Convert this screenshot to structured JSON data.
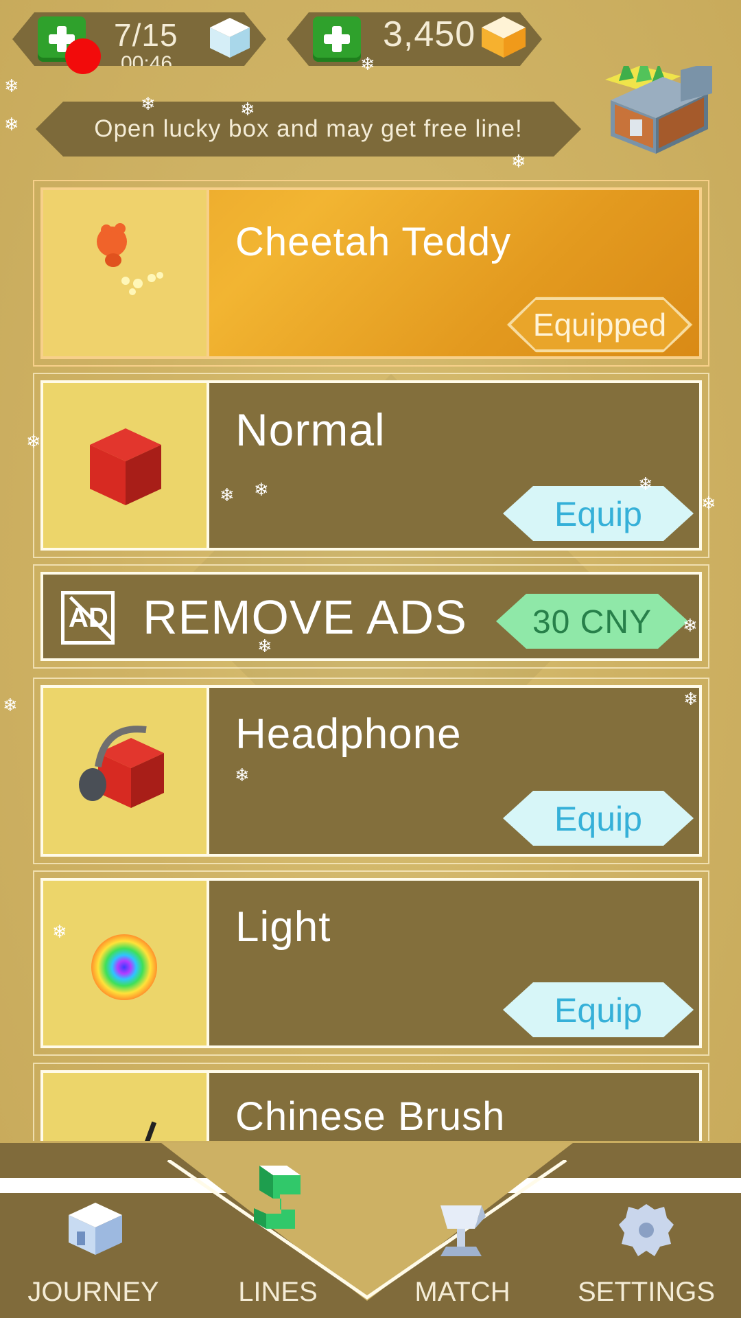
{
  "hud": {
    "energy_count": "7/15",
    "energy_timer": "00:46",
    "coins": "3,450"
  },
  "banner": {
    "lucky_text": "Open lucky box and may get free line!"
  },
  "lines": [
    {
      "title": "Cheetah Teddy",
      "button": "Equipped",
      "state": "equipped"
    },
    {
      "title": "Normal",
      "button": "Equip",
      "state": "available"
    },
    {
      "title": "Headphone",
      "button": "Equip",
      "state": "available"
    },
    {
      "title": "Light",
      "button": "Equip",
      "state": "available"
    },
    {
      "title": "Chinese Brush",
      "button": "",
      "state": "available"
    }
  ],
  "remove_ads": {
    "label": "REMOVE ADS",
    "icon_text": "AD",
    "price": "30 CNY"
  },
  "nav": {
    "journey": "JOURNEY",
    "lines": "LINES",
    "match": "MATCH",
    "settings": "SETTINGS"
  },
  "colors": {
    "background": "#cdb164",
    "panel": "#836f3c",
    "equipped_orange": "#f2b532",
    "equip_button": "#d7f6f8",
    "price_button": "#8fe8a8",
    "record_dot": "#f20b0b"
  }
}
